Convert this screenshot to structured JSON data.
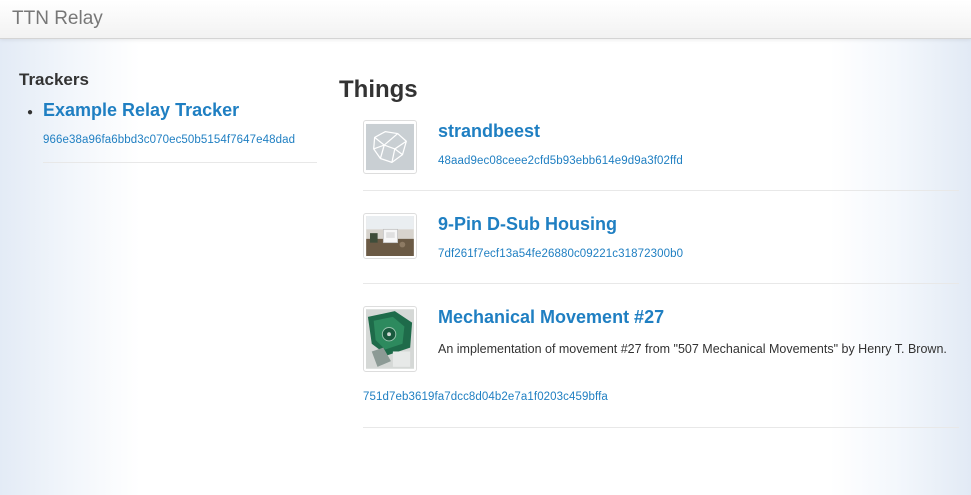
{
  "app": {
    "brand": "TTN Relay"
  },
  "sidebar": {
    "heading": "Trackers",
    "trackers": [
      {
        "name": "Example Relay Tracker",
        "id": "966e38a96fa6bbd3c070ec50b5154f7647e48dad"
      }
    ]
  },
  "main": {
    "title": "Things",
    "things": [
      {
        "name": "strandbeest",
        "id": "48aad9ec08ceee2cfd5b93ebb614e9d9a3f02ffd",
        "description": "",
        "thumbnail_icon": "strandbeest-thumbnail"
      },
      {
        "name": "9-Pin D-Sub Housing",
        "id": "7df261f7ecf13a54fe26880c09221c31872300b0",
        "description": "",
        "thumbnail_icon": "dsub-housing-thumbnail"
      },
      {
        "name": "Mechanical Movement #27",
        "id": "751d7eb3619fa7dcc8d04b2e7a1f0203c459bffa",
        "description": "An implementation of movement #27 from \"507 Mechanical Movements\" by Henry T. Brown.",
        "thumbnail_icon": "mechanical-movement-thumbnail"
      }
    ]
  },
  "colors": {
    "link": "#1f7fc2",
    "text": "#333333",
    "brand_text": "#777777"
  }
}
